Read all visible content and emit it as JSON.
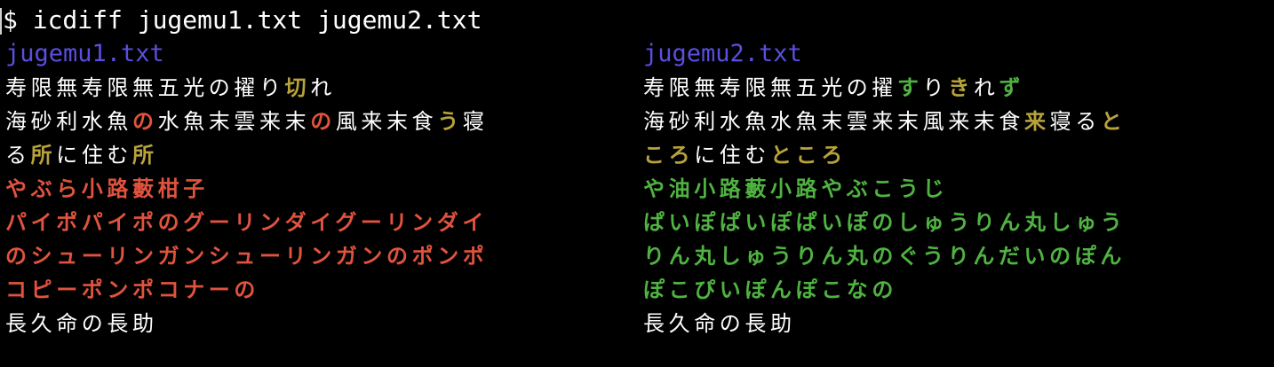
{
  "colors": {
    "background": "#000000",
    "text": "#ffffff",
    "filename": "#5a4fe0",
    "removed": "#e0533e",
    "added": "#4fb341",
    "changed": "#b8a33a"
  },
  "terminal": {
    "prompt": "$ icdiff jugemu1.txt jugemu2.txt"
  },
  "left": {
    "filename": "jugemu1.txt",
    "lines": [
      [
        {
          "text": "寿限無寿限無五光の擢り",
          "style": "normal"
        },
        {
          "text": "切",
          "style": "changed"
        },
        {
          "text": "れ",
          "style": "normal"
        }
      ],
      [
        {
          "text": "海砂利水魚",
          "style": "normal"
        },
        {
          "text": "の",
          "style": "removed"
        },
        {
          "text": "水魚末雲来末",
          "style": "normal"
        },
        {
          "text": "の",
          "style": "removed"
        },
        {
          "text": "風来末食",
          "style": "normal"
        },
        {
          "text": "う",
          "style": "changed"
        },
        {
          "text": "寝",
          "style": "normal"
        }
      ],
      [
        {
          "text": "る",
          "style": "normal"
        },
        {
          "text": "所",
          "style": "changed"
        },
        {
          "text": "に住む",
          "style": "normal"
        },
        {
          "text": "所",
          "style": "changed"
        }
      ],
      [
        {
          "text": "やぶら小路藪柑子",
          "style": "removed"
        }
      ],
      [
        {
          "text": "パイポパイポのグーリンダイグーリンダイ",
          "style": "removed"
        }
      ],
      [
        {
          "text": "のシューリンガンシューリンガンのポンポ",
          "style": "removed"
        }
      ],
      [
        {
          "text": "コピーポンポコナーの",
          "style": "removed"
        }
      ],
      [
        {
          "text": "長久命の長助",
          "style": "normal"
        }
      ]
    ]
  },
  "right": {
    "filename": "jugemu2.txt",
    "lines": [
      [
        {
          "text": "寿限無寿限無五光の擢",
          "style": "normal"
        },
        {
          "text": "す",
          "style": "added"
        },
        {
          "text": "り",
          "style": "normal"
        },
        {
          "text": "き",
          "style": "changed"
        },
        {
          "text": "れ",
          "style": "normal"
        },
        {
          "text": "ず",
          "style": "added"
        }
      ],
      [
        {
          "text": "海砂利水魚水魚末雲来末風来末食",
          "style": "normal"
        },
        {
          "text": "来",
          "style": "changed"
        },
        {
          "text": "寝る",
          "style": "normal"
        },
        {
          "text": "と",
          "style": "changed"
        }
      ],
      [
        {
          "text": "ころ",
          "style": "changed"
        },
        {
          "text": "に住む",
          "style": "normal"
        },
        {
          "text": "ところ",
          "style": "changed"
        }
      ],
      [
        {
          "text": "や油小路藪小路やぶこうじ",
          "style": "added"
        }
      ],
      [
        {
          "text": "ぱいぽぱいぽぱいぽのしゅうりん丸しゅう",
          "style": "added"
        }
      ],
      [
        {
          "text": "りん丸しゅうりん丸のぐうりんだいのぽん",
          "style": "added"
        }
      ],
      [
        {
          "text": "ぽこぴいぽんぽこなの",
          "style": "added"
        }
      ],
      [
        {
          "text": "長久命の長助",
          "style": "normal"
        }
      ]
    ]
  }
}
